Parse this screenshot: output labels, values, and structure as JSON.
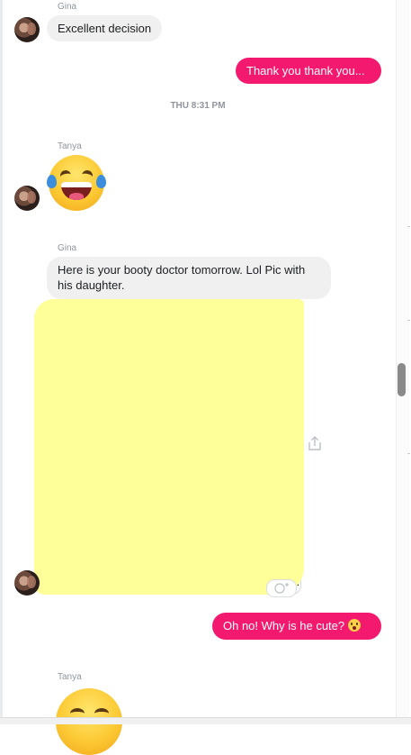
{
  "messages": {
    "m1_sender": "Gina",
    "m1_text": "Excellent decision",
    "m2_text": "Thank you thank you...",
    "timestamp": "THU 8:31 PM",
    "m3_sender": "Tanya",
    "m3_emoji": "face-with-tears-of-joy",
    "m4_sender": "Gina",
    "m4_text": "Here is your booty doctor tomorrow. Lol Pic with his daughter.",
    "m5_text": "Oh no! Why is he cute?",
    "m6_sender": "Tanya"
  },
  "icons": {
    "share": "share-icon",
    "react": "add-reaction-icon",
    "flushed": "flushed-face-emoji"
  },
  "colors": {
    "outgoing_bubble": "#f2196f",
    "incoming_bubble": "#f1f0f0",
    "highlight": "#ffff99"
  }
}
